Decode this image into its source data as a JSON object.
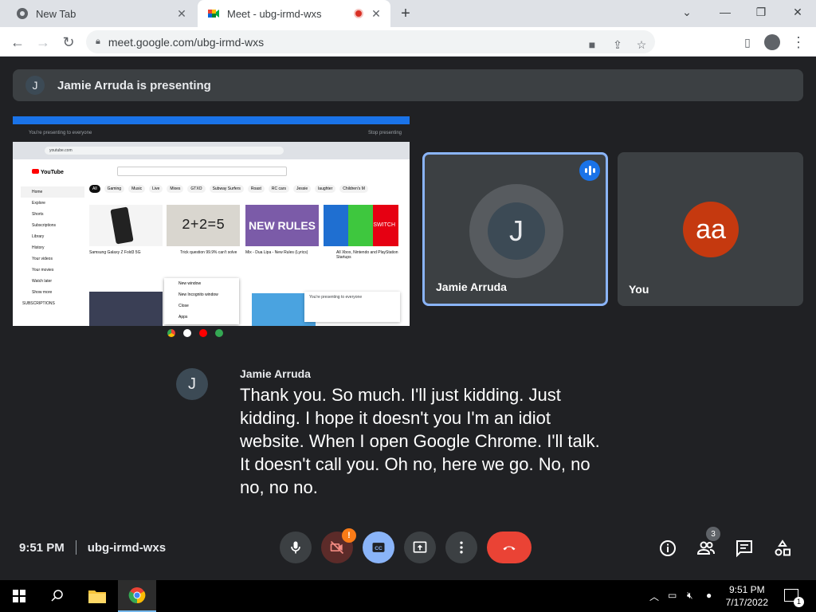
{
  "browser": {
    "tabs": [
      {
        "title": "New Tab",
        "active": false
      },
      {
        "title": "Meet - ubg-irmd-wxs",
        "active": true,
        "recording": true
      }
    ],
    "url": "meet.google.com/ubg-irmd-wxs"
  },
  "meet": {
    "presenting_banner": {
      "initial": "J",
      "text": "Jamie Arruda is presenting"
    },
    "participants": [
      {
        "name": "Jamie Arruda",
        "initial": "J",
        "speaking": true
      },
      {
        "name": "You",
        "initial": "aa",
        "speaking": false
      }
    ],
    "caption": {
      "initial": "J",
      "speaker": "Jamie Arruda",
      "text": "Thank you. So much. I'll just kidding. Just kidding. I hope it doesn't you I'm an idiot website. When I open Google Chrome. I'll talk. It doesn't call you. Oh no, here we go. No, no no, no no."
    },
    "time": "9:51 PM",
    "meeting_code": "ubg-irmd-wxs",
    "camera_alert": "!",
    "participant_count": "3",
    "colors": {
      "accent": "#8ab4f8",
      "end_call": "#ea4335",
      "avatar_you": "#c5390f"
    }
  },
  "shared_screen": {
    "top_bar_left": "You're presenting to everyone",
    "top_bar_right": "Stop presenting",
    "address": "youtube.com",
    "chips": [
      "All",
      "Gaming",
      "Music",
      "Live",
      "Mixes",
      "GTXO",
      "Subway Surfers",
      "Roast",
      "RC cars",
      "Jessie",
      "laughter",
      "Children's M"
    ],
    "sidebar": [
      "Home",
      "Explore",
      "Shorts",
      "Subscriptions",
      "Library",
      "History",
      "Your videos",
      "Your movies",
      "Watch later",
      "Show more",
      "SUBSCRIPTIONS"
    ],
    "thumbs": [
      "",
      "2+2=5",
      "NEW RULES",
      "SWITCH"
    ],
    "video_titles": [
      "Samsung Galaxy Z Fold3 5G",
      "Trick question 99.9% can't solve",
      "Mix - Dua Lipa - New Rules (Lyrics)",
      "All Xbox, Nintendo and PlayStation Startups"
    ],
    "context_menu": [
      "New window",
      "New Incognito window",
      "Close",
      "Apps"
    ],
    "toast": "You're presenting to everyone"
  },
  "taskbar": {
    "time": "9:51 PM",
    "date": "7/17/2022",
    "notifications": "1"
  }
}
